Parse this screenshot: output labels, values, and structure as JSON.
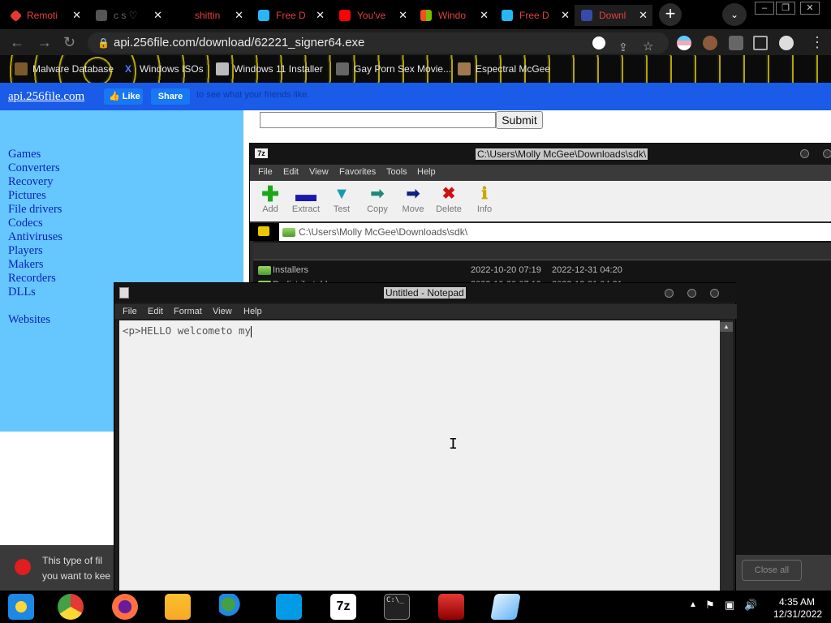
{
  "browser": {
    "tabs": [
      {
        "label": "Remoti",
        "favicon_color": "#e53935"
      },
      {
        "label": "c s ♡",
        "favicon_color": "#555555"
      },
      {
        "label": "shittin",
        "favicon_color": "#d81b60"
      },
      {
        "label": "Free D",
        "favicon_color": "#29b6f6"
      },
      {
        "label": "You've",
        "favicon_color": "#ff0000"
      },
      {
        "label": "Windo",
        "favicon_color": "#4caf50"
      },
      {
        "label": "Free D",
        "favicon_color": "#29b6f6"
      },
      {
        "label": "Downl",
        "favicon_color": "#3949ab"
      }
    ],
    "new_tab_label": "+",
    "url": "api.256file.com/download/62221_signer64.exe",
    "bookmarks": [
      {
        "label": "Malware Database",
        "icon": "malware-icon"
      },
      {
        "label": "Windows ISOs",
        "icon": "x-icon"
      },
      {
        "label": "Windows 11 Installer",
        "icon": "installer-icon"
      },
      {
        "label": "Gay Porn Sex Movie...",
        "icon": "site-icon"
      },
      {
        "label": "Espectral McGee",
        "icon": "site-icon"
      }
    ]
  },
  "site": {
    "link": "api.256file.com",
    "fb_like": "Like",
    "fb_share": "Share",
    "fb_text": "to see what your friends like.",
    "categories": [
      "Games",
      "Converters",
      "Recovery",
      "Pictures",
      "File drivers",
      "Codecs",
      "Antiviruses",
      "Players",
      "Makers",
      "Recorders",
      "DLLs"
    ],
    "websites": "Websites",
    "submit_label": "Submit",
    "search_value": ""
  },
  "download_warning": {
    "text_line1": "This type of fil",
    "text_line2": "you want to kee"
  },
  "sevenzip": {
    "title": "C:\\Users\\Molly McGee\\Downloads\\sdk\\",
    "menu": [
      "File",
      "Edit",
      "View",
      "Favorites",
      "Tools",
      "Help"
    ],
    "tools": [
      {
        "label": "Add",
        "icon": "plus-icon",
        "color": "#1aa81a"
      },
      {
        "label": "Extract",
        "icon": "minus-icon",
        "color": "#1a1aa8"
      },
      {
        "label": "Test",
        "icon": "check-icon",
        "color": "#1a9ab0"
      },
      {
        "label": "Copy",
        "icon": "copy-arrow-icon",
        "color": "#1a8a7a"
      },
      {
        "label": "Move",
        "icon": "move-arrow-icon",
        "color": "#102080"
      },
      {
        "label": "Delete",
        "icon": "delete-x-icon",
        "color": "#d01010"
      },
      {
        "label": "Info",
        "icon": "info-icon",
        "color": "#c8a800"
      }
    ],
    "path": "C:\\Users\\Molly McGee\\Downloads\\sdk\\",
    "rows": [
      {
        "name": "Installers",
        "modified": "2022-10-20 07:19",
        "created": "2022-12-31 04:20"
      },
      {
        "name": "Redistributable",
        "modified": "2022-10-20 07:19",
        "created": "2022-12-31 04:21"
      }
    ],
    "close_all": "Close all"
  },
  "notepad": {
    "title": "Untitled - Notepad",
    "menu": [
      "File",
      "Edit",
      "Format",
      "View",
      "Help"
    ],
    "content": "<p>HELLO welcometo my"
  },
  "taskbar": {
    "apps": [
      {
        "name": "windows-start-icon",
        "color": "#1e88e5"
      },
      {
        "name": "chrome-icon",
        "color": "#e53935"
      },
      {
        "name": "firefox-icon",
        "color": "#ff7043"
      },
      {
        "name": "file-explorer-icon",
        "color": "#fdd835"
      },
      {
        "name": "network-users-icon",
        "color": "#43a047"
      },
      {
        "name": "arrow-app-icon",
        "color": "#039be5"
      },
      {
        "name": "sevenzip-taskbar-icon",
        "color": "#ffffff"
      },
      {
        "name": "cmd-icon",
        "color": "#222222"
      },
      {
        "name": "toolbox-icon",
        "color": "#c62828"
      },
      {
        "name": "notepad-taskbar-icon",
        "color": "#90caf9"
      }
    ],
    "sevenzip_label": "7z",
    "cmd_label": "C:\\_",
    "time": "4:35 AM",
    "date": "12/31/2022"
  }
}
